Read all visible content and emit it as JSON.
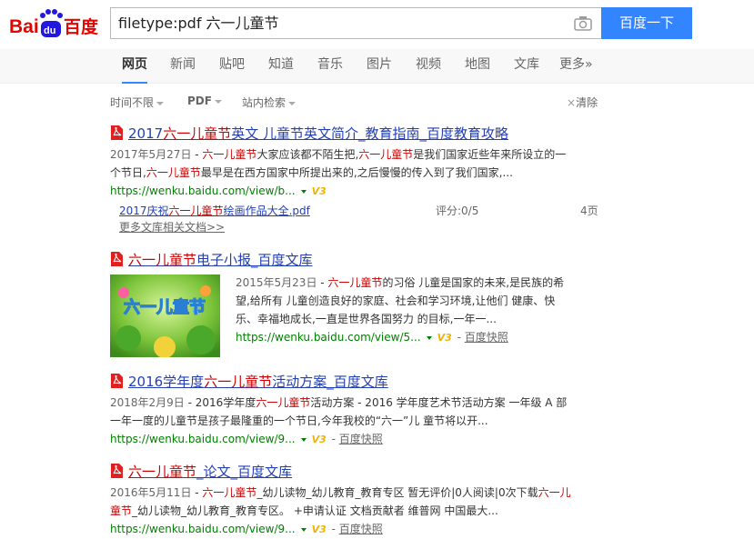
{
  "header": {
    "logo_text_left": "Bai",
    "logo_text_du": "du",
    "logo_text_right": "百度",
    "search_value": "filetype:pdf 六一儿童节",
    "search_button": "百度一下"
  },
  "nav": {
    "items": [
      "网页",
      "新闻",
      "贴吧",
      "知道",
      "音乐",
      "图片",
      "视频",
      "地图",
      "文库",
      "更多»"
    ]
  },
  "tools": {
    "time": "时间不限",
    "filetype": "PDF",
    "site": "站内检索",
    "clear": "清除"
  },
  "results": [
    {
      "title_a": "2017",
      "title_b": "六一儿童节",
      "title_c": "英文 儿童节英文简介_教育指南_百度教育攻略",
      "date": "2017年5月27日",
      "abs1_a": "六一儿童节",
      "abs1_b": "大家应该都不陌生把,",
      "abs1_c": "六一儿童节",
      "abs1_d": "是我们国家近些年来所设立的一",
      "abs2_a": "个节日,",
      "abs2_b": "六一儿童节",
      "abs2_c": "最早是在西方国家中所提出来的,之后慢慢的传入到了我们国家,...",
      "url": "https://wenku.baidu.com/view/b...",
      "sub_a": "2017庆祝",
      "sub_b": "六一儿童节",
      "sub_c": "绘画作品大全.pdf",
      "sub_score": "评分:0/5",
      "sub_pages": "4页",
      "more": "更多文库相关文档>>"
    },
    {
      "title_a": "",
      "title_b": "六一儿童节",
      "title_c": "电子小报_百度文库",
      "date": "2015年5月23日",
      "abs1_a": "六一儿童节",
      "abs1_b": "的习俗 儿童是国家的未来,是民族的希",
      "abs2": "望,给所有 儿童创造良好的家庭、社会和学习环境,让他们 健康、快",
      "abs3": "乐、幸福地成长,一直是世界各国努力 的目标,一年一...",
      "url": "https://wenku.baidu.com/view/5...",
      "snapshot": "百度快照",
      "thumb_text": "六一儿童节"
    },
    {
      "title_a": "2016学年度",
      "title_b": "六一儿童节",
      "title_c": "活动方案_百度文库",
      "date": "2018年2月9日",
      "abs1_a": "2016学年度",
      "abs1_b": "六一儿童节",
      "abs1_c": "活动方案 - 2016 学年度艺术节活动方案 一年级 A 部",
      "abs2": "一年一度的儿童节是孩子最隆重的一个节日,今年我校的“六一”儿 童节将以开...",
      "url": "https://wenku.baidu.com/view/9...",
      "snapshot": "百度快照"
    },
    {
      "title_a": "",
      "title_b": "六一儿童节",
      "title_c": "_论文_百度文库",
      "date": "2016年5月11日",
      "abs1_a": "六一儿童节",
      "abs1_b": "_幼儿读物_幼儿教育_教育专区 暂无评价|0人阅读|0次下载",
      "abs1_c": "六一儿",
      "abs2_a": "童节",
      "abs2_b": "_幼儿读物_幼儿教育_教育专区。 +申请认证 文档贡献者 维普网 中国最大...",
      "url": "https://wenku.baidu.com/view/9...",
      "snapshot": "百度快照"
    }
  ],
  "icons": {
    "logo": "baidu-paw-logo",
    "camera": "camera-icon",
    "pdf": "pdf-icon",
    "v3": "v3-badge-icon",
    "clear": "close-icon"
  },
  "colors": {
    "accent": "#3385ff",
    "link": "#2440b3",
    "highlight": "#cc0000",
    "url": "#008000",
    "logo_red": "#e10602",
    "logo_blue": "#2319dc"
  },
  "v3_label": "V3"
}
